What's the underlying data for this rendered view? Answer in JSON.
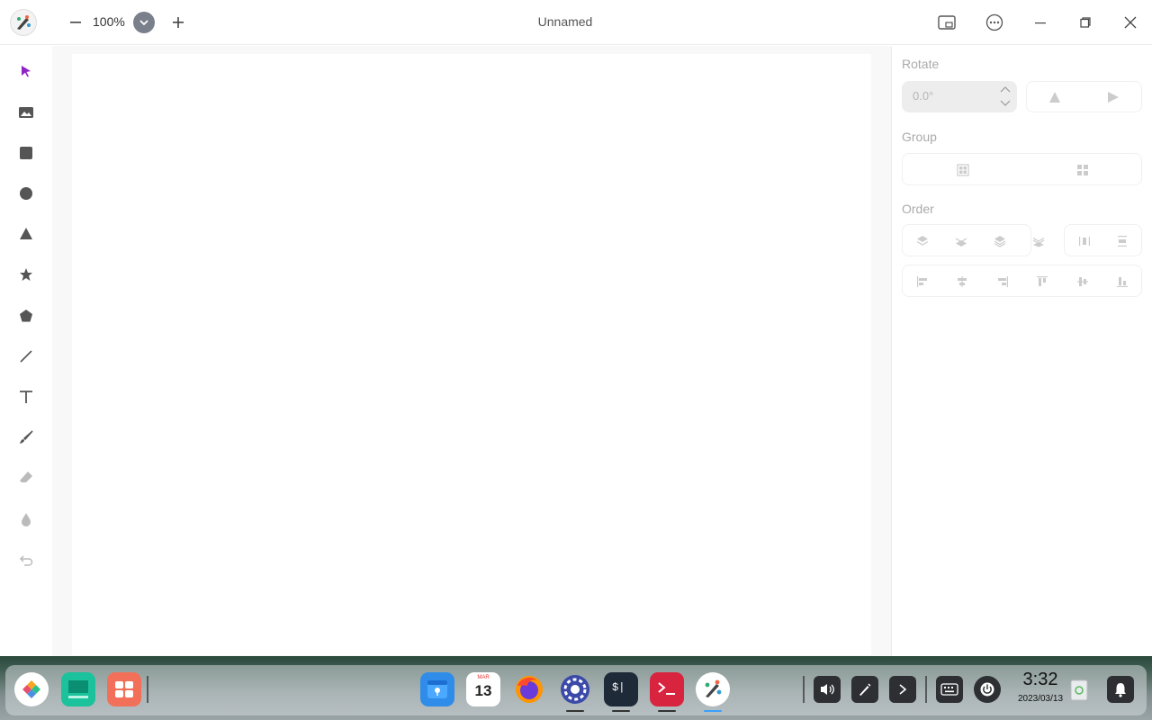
{
  "titlebar": {
    "zoom_value": "100%",
    "document_title": "Unnamed"
  },
  "toolbar": {
    "tools": [
      "select-icon",
      "image-icon",
      "rectangle-icon",
      "ellipse-icon",
      "triangle-icon",
      "star-icon",
      "polygon-icon",
      "line-icon",
      "text-icon",
      "brush-icon",
      "eraser-icon",
      "blur-icon",
      "undo-icon"
    ],
    "active_color": "#8e24c8"
  },
  "panel": {
    "rotate_label": "Rotate",
    "rotate_value": "0.0°",
    "group_label": "Group",
    "order_label": "Order"
  },
  "taskbar": {
    "calendar_month": "MAR",
    "calendar_day": "13",
    "time": "3:32",
    "date": "2023/03/13"
  }
}
